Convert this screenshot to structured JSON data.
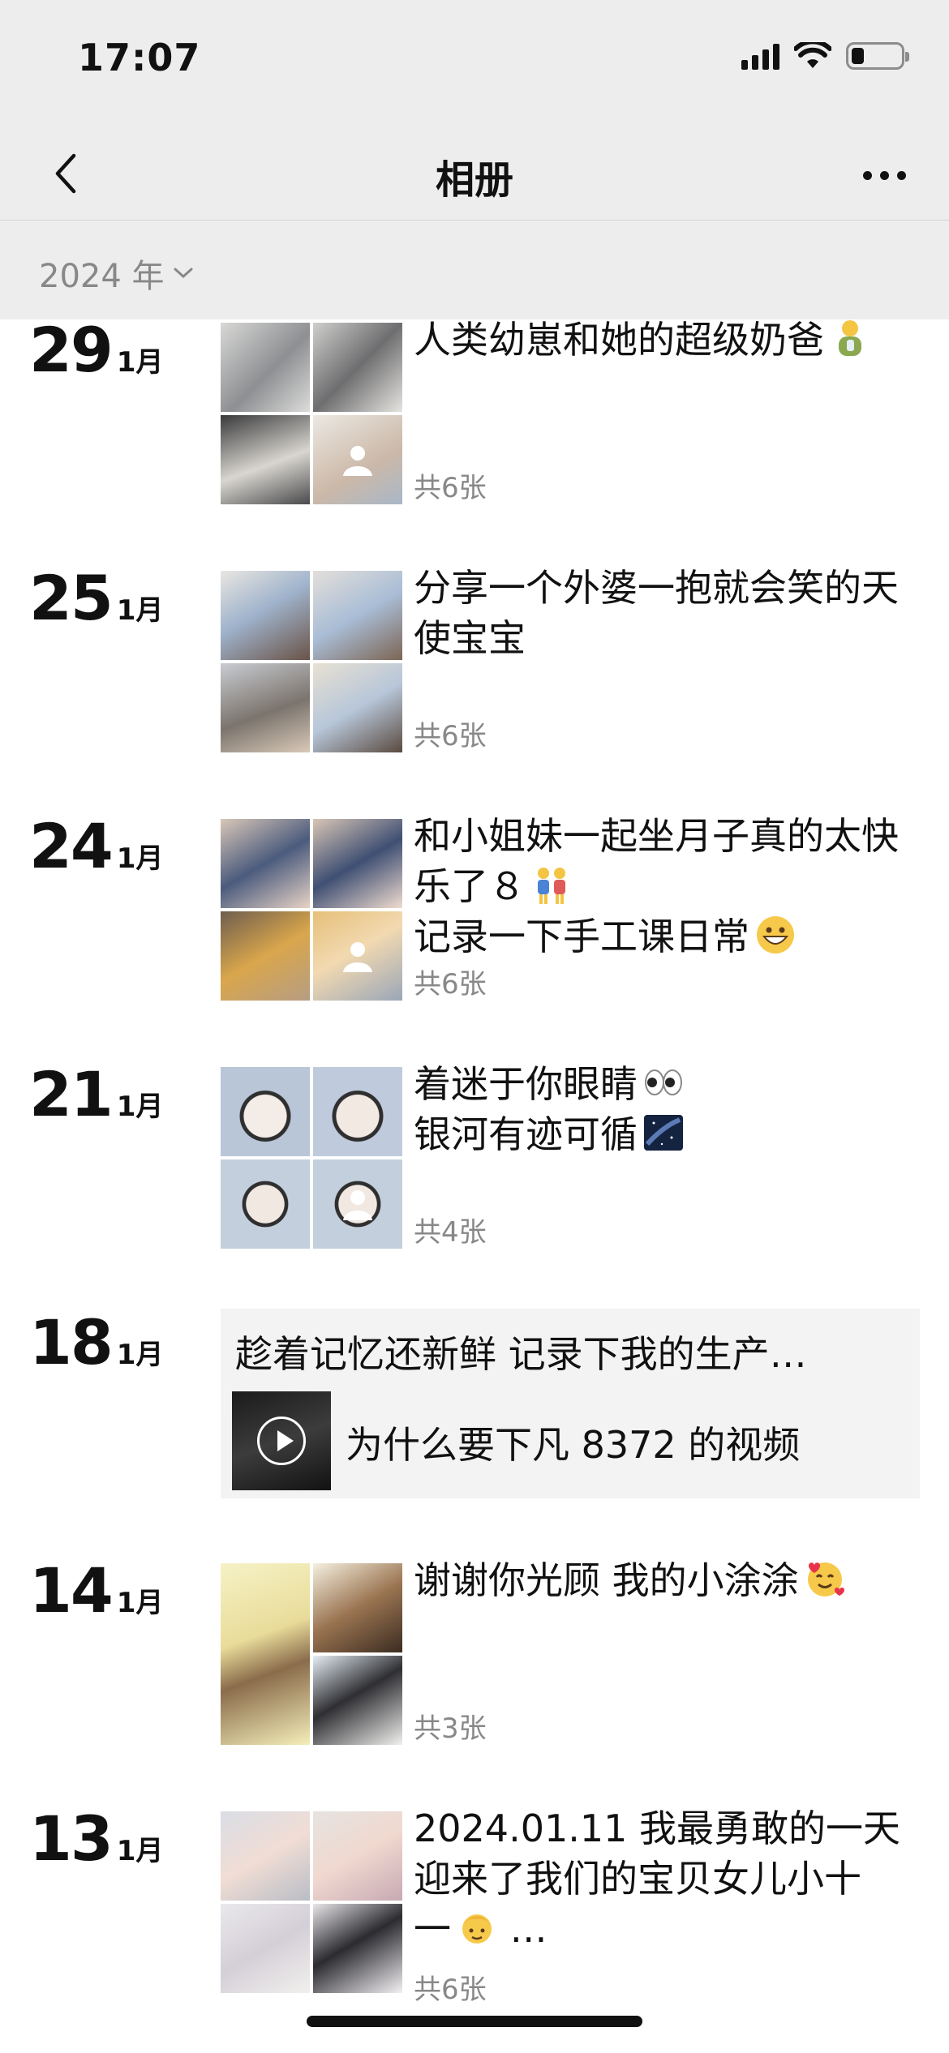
{
  "status_bar": {
    "time": "17:07",
    "battery_level": 0.25
  },
  "nav": {
    "title": "相册",
    "back_icon": "chevron-left-icon",
    "more_icon": "more-dots-icon"
  },
  "year_filter": {
    "label": "2024 年",
    "icon": "chevron-down-icon"
  },
  "posts": [
    {
      "day": "29",
      "month": "1月",
      "caption": "人类幼崽和她的超级奶爸",
      "count": "共6张"
    },
    {
      "day": "25",
      "month": "1月",
      "caption": "分享一个外婆一抱就会笑的天使宝宝",
      "count": "共6张"
    },
    {
      "day": "24",
      "month": "1月",
      "caption_line1": "和小姐妹一起坐月子真的太快乐了８",
      "caption_line2": "记录一下手工课日常",
      "count": "共6张"
    },
    {
      "day": "21",
      "month": "1月",
      "caption_line1": "着迷于你眼睛",
      "caption_line2": "银河有迹可循",
      "count": "共4张"
    },
    {
      "day": "18",
      "month": "1月",
      "video_title": "趁着记忆还新鲜 记录下我的生产…",
      "video_text": "为什么要下凡 8372 的视频"
    },
    {
      "day": "14",
      "month": "1月",
      "caption": "谢谢你光顾 我的小涂涂",
      "count": "共3张"
    },
    {
      "day": "13",
      "month": "1月",
      "caption_line1": "2024.01.11 我最勇敢的一天",
      "caption_line2": "迎来了我们的宝贝女儿小十",
      "caption_line3": "一",
      "caption_line3_tail": " …",
      "count": "共6张"
    }
  ]
}
